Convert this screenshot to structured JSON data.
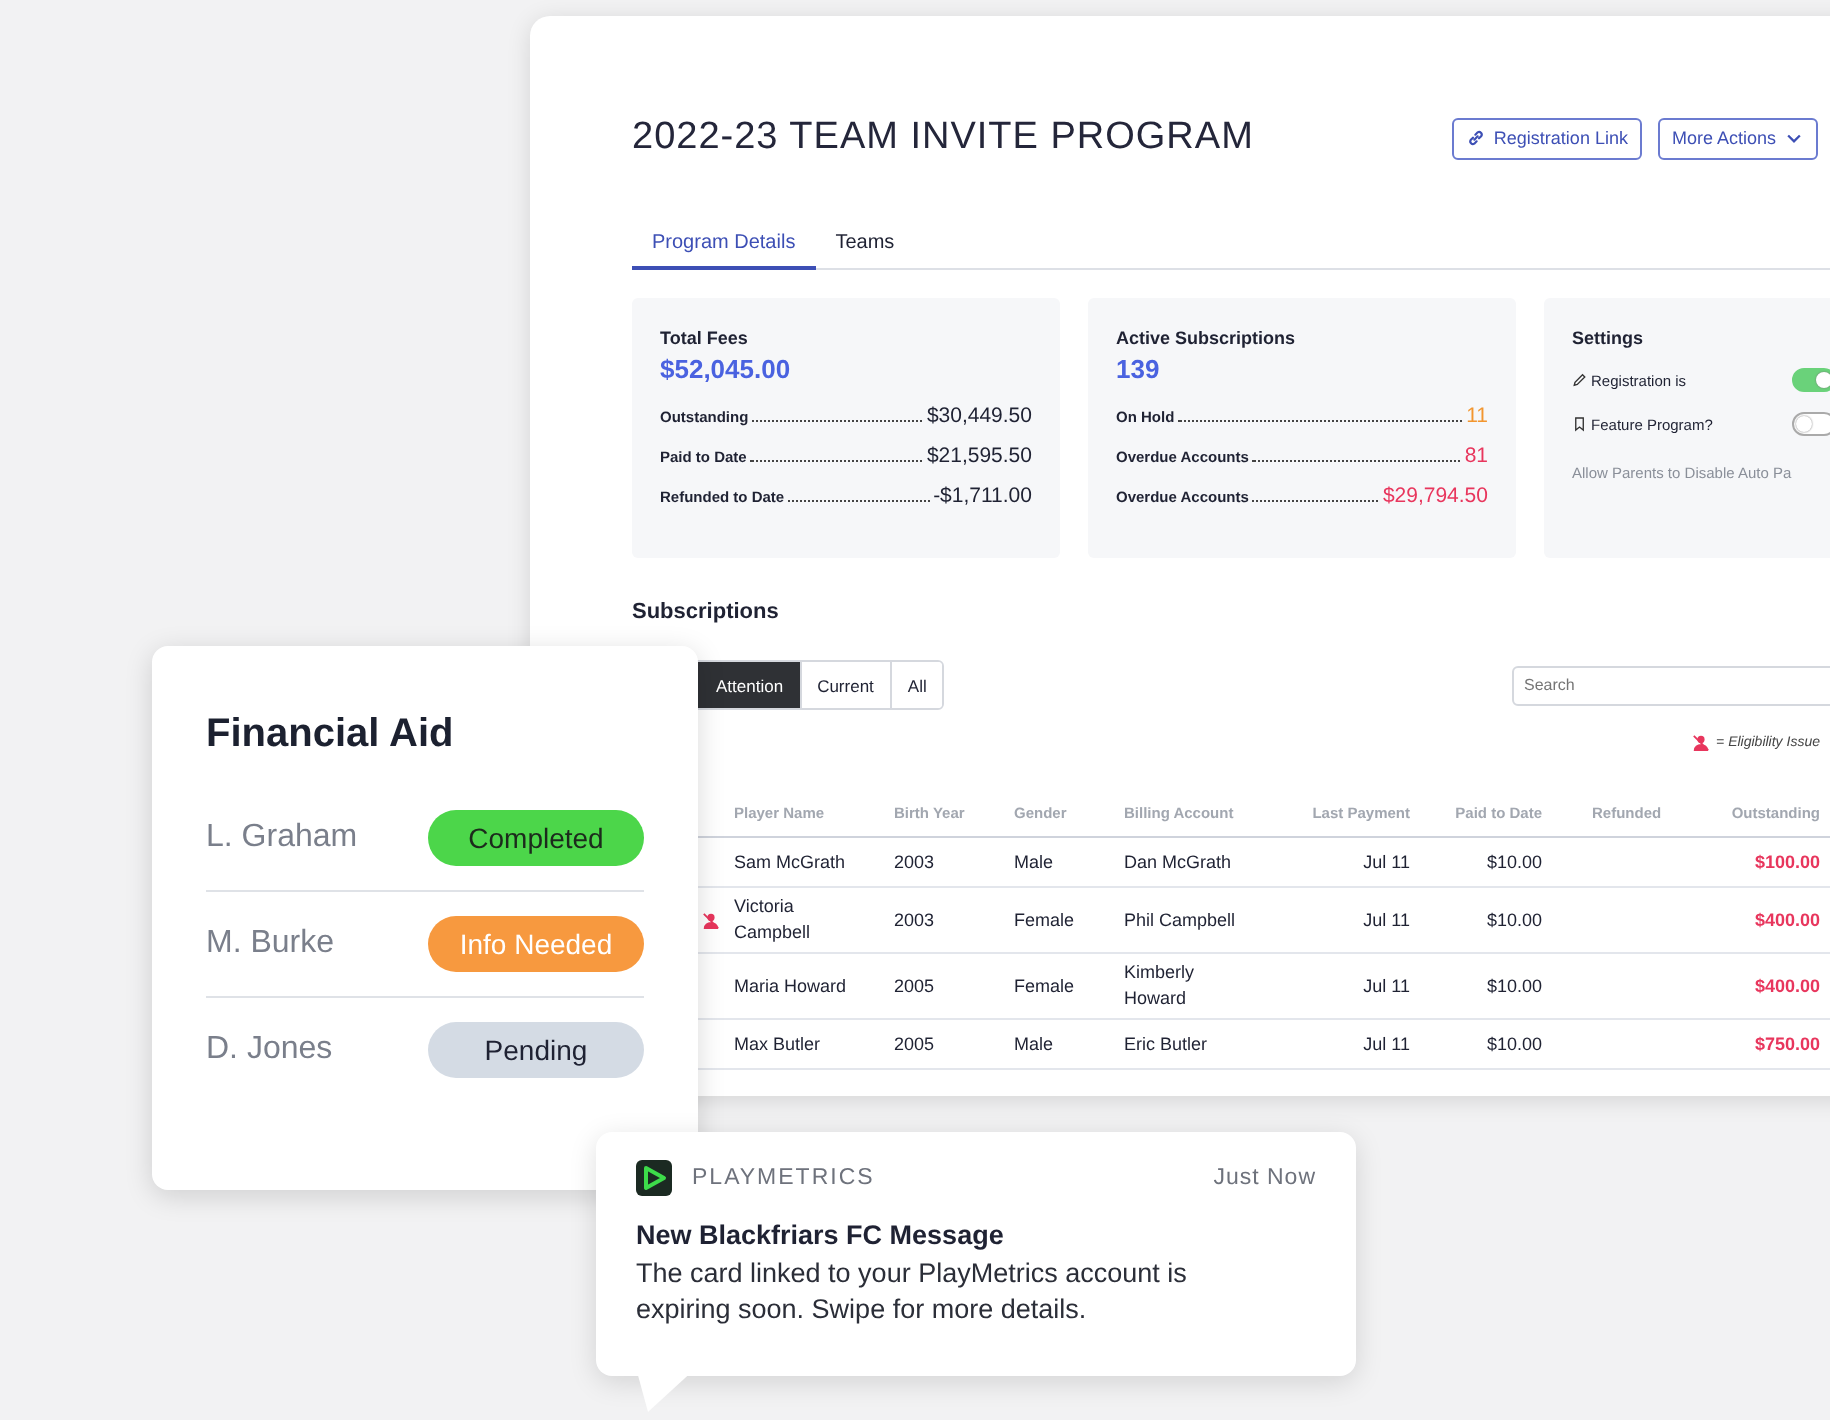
{
  "program": {
    "title": "2022-23 TEAM INVITE PROGRAM",
    "actions": [
      {
        "label": "Registration Link",
        "kind": "link"
      },
      {
        "label": "More Actions",
        "kind": "menu"
      }
    ],
    "tabs": [
      {
        "label": "Program Details",
        "selected": true
      },
      {
        "label": "Teams",
        "selected": false
      }
    ],
    "stats": [
      {
        "title": "Total Fees",
        "total": "$52,045.00",
        "rows": [
          {
            "label": "Outstanding",
            "value": "$30,449.50",
            "color": "#1f2233"
          },
          {
            "label": "Paid to Date",
            "value": "$21,595.50",
            "color": "#1f2233"
          },
          {
            "label": "Refunded to Date",
            "value": "-$1,711.00",
            "color": "#1f2233"
          }
        ]
      },
      {
        "title": "Active Subscriptions",
        "total": "139",
        "rows": [
          {
            "label": "On Hold",
            "value": "11",
            "color": "#f2962f"
          },
          {
            "label": "Overdue Accounts",
            "value": "81",
            "color": "#e8365d"
          },
          {
            "label": "Overdue Accounts",
            "value": "$29,794.50",
            "color": "#e8365d"
          }
        ]
      }
    ],
    "settings": {
      "title": "Settings",
      "items": [
        {
          "label": "Registration is",
          "kind": "pencil",
          "on": true
        },
        {
          "label": "Feature Program?",
          "kind": "bookmark",
          "on": false
        }
      ],
      "note": "Allow Parents to Disable Auto Pa"
    }
  },
  "subscriptions": {
    "title": "Subscriptions",
    "filters": [
      {
        "label": "Attention",
        "selected": true
      },
      {
        "label": "Current",
        "selected": false
      },
      {
        "label": "All",
        "selected": false
      }
    ],
    "search": {
      "placeholder": "Search"
    },
    "legend": "= Eligibility Issue",
    "columns": [
      "Player Name",
      "Birth Year",
      "Gender",
      "Billing Account",
      "Last Payment",
      "Paid to Date",
      "Refunded",
      "Outstanding"
    ],
    "rows": [
      {
        "flagged": false,
        "cells": [
          "Sam McGrath",
          "2003",
          "Male",
          "Dan McGrath",
          "Jul 11",
          "$10.00",
          "",
          "$100.00"
        ]
      },
      {
        "flagged": true,
        "cells": [
          "Victoria Campbell",
          "2003",
          "Female",
          "Phil Campbell",
          "Jul 11",
          "$10.00",
          "",
          "$400.00"
        ]
      },
      {
        "flagged": false,
        "cells": [
          "Maria Howard",
          "2005",
          "Female",
          "Kimberly Howard",
          "Jul 11",
          "$10.00",
          "",
          "$400.00"
        ]
      },
      {
        "flagged": false,
        "cells": [
          "Max Butler",
          "2005",
          "Male",
          "Eric Butler",
          "Jul 11",
          "$10.00",
          "",
          "$750.00"
        ]
      }
    ]
  },
  "financial_aid": {
    "title": "Financial Aid",
    "items": [
      {
        "name": "L. Graham",
        "status": "Completed",
        "kind": "completed"
      },
      {
        "name": "M. Burke",
        "status": "Info Needed",
        "kind": "info_needed"
      },
      {
        "name": "D. Jones",
        "status": "Pending",
        "kind": "pending"
      }
    ]
  },
  "notification": {
    "app": "PLAYMETRICS",
    "time": "Just Now",
    "title": "New Blackfriars FC Message",
    "body": "The card linked to your PlayMetrics account is expiring soon. Swipe for more details."
  }
}
